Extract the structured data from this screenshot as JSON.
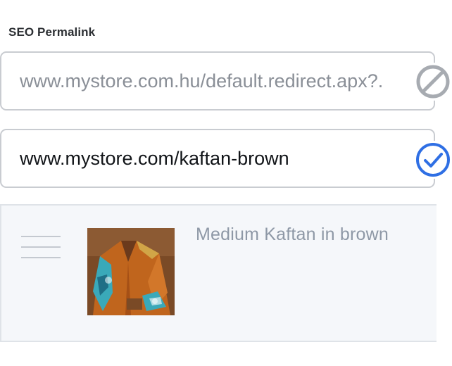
{
  "seo": {
    "label": "SEO Permalink",
    "old_url": "www.mystore.com.hu/default.redirect.apx?.",
    "old_url_status_icon": "blocked-icon",
    "new_url": "www.mystore.com/kaftan-brown",
    "new_url_status_icon": "check-circle-icon"
  },
  "product": {
    "title": "Medium Kaftan in brown",
    "drag_icon": "drag-handle-icon",
    "image_alt": "brown kaftan with turquoise print"
  },
  "colors": {
    "accent_blue": "#2f6fe4",
    "blocked_gray": "#a7abb1",
    "border": "#c9ccd1",
    "row_bg": "#f5f7fa"
  }
}
